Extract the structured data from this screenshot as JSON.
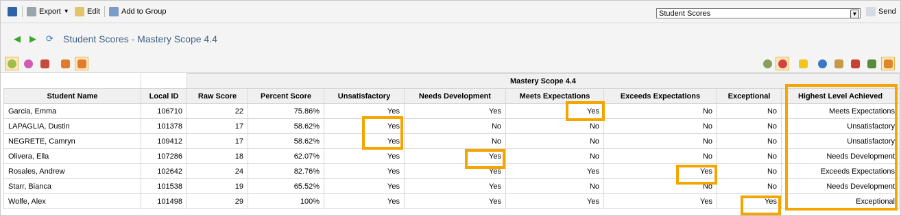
{
  "toolbar": {
    "export_label": "Export",
    "edit_label": "Edit",
    "add_group_label": "Add to Group",
    "view_select": "Student Scores",
    "send_label": "Send"
  },
  "page": {
    "title": "Student Scores - Mastery Scope 4.4"
  },
  "table": {
    "group_header": "Mastery Scope 4.4",
    "columns": [
      "Student Name",
      "Local ID",
      "Raw Score",
      "Percent Score",
      "Unsatisfactory",
      "Needs Development",
      "Meets Expectations",
      "Exceeds Expectations",
      "Exceptional",
      "Highest Level Achieved"
    ],
    "rows": [
      [
        "Garcia, Emma",
        "106710",
        "22",
        "75.86%",
        "Yes",
        "Yes",
        "Yes",
        "No",
        "No",
        "Meets Expectations"
      ],
      [
        "LAPAGLIA, Dustin",
        "101378",
        "17",
        "58.62%",
        "Yes",
        "No",
        "No",
        "No",
        "No",
        "Unsatisfactory"
      ],
      [
        "NEGRETE, Camryn",
        "109412",
        "17",
        "58.62%",
        "Yes",
        "No",
        "No",
        "No",
        "No",
        "Unsatisfactory"
      ],
      [
        "Olivera, Ella",
        "107286",
        "18",
        "62.07%",
        "Yes",
        "Yes",
        "No",
        "No",
        "No",
        "Needs Development"
      ],
      [
        "Rosales, Andrew",
        "102642",
        "24",
        "82.76%",
        "Yes",
        "Yes",
        "Yes",
        "Yes",
        "No",
        "Exceeds Expectations"
      ],
      [
        "Starr, Bianca",
        "101538",
        "19",
        "65.52%",
        "Yes",
        "Yes",
        "No",
        "No",
        "No",
        "Needs Development"
      ],
      [
        "Wolfe, Alex",
        "101498",
        "29",
        "100%",
        "Yes",
        "Yes",
        "Yes",
        "Yes",
        "Yes",
        "Exceptional"
      ]
    ]
  },
  "colors": {
    "highlight": "#f5a500",
    "title": "#3f6287"
  },
  "icons": [
    "save-icon",
    "printer-icon",
    "pencil-icon",
    "group-icon",
    "envelope-icon",
    "back-arrow-icon",
    "forward-arrow-icon",
    "refresh-icon"
  ]
}
